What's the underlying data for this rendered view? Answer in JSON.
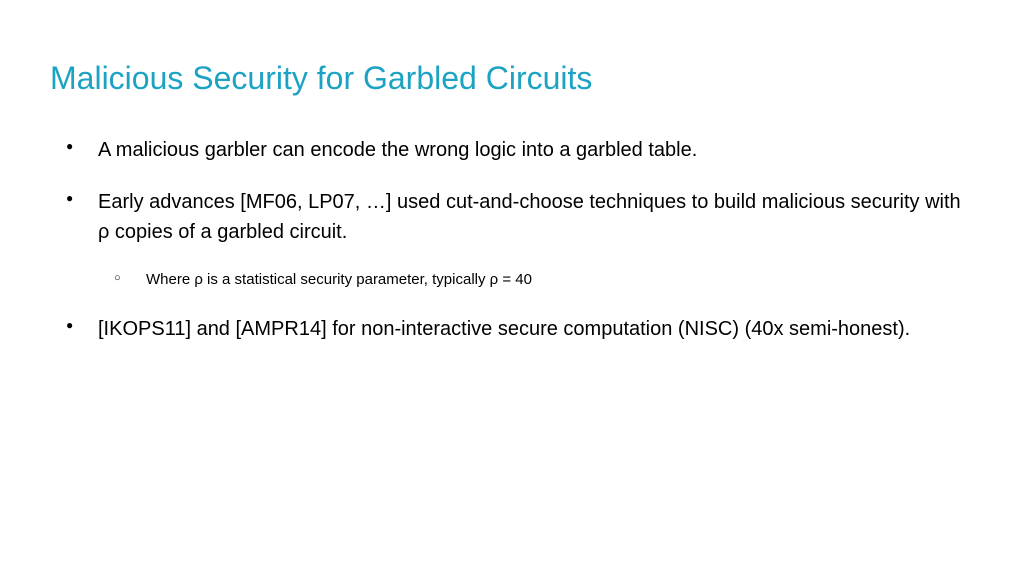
{
  "slide": {
    "title": "Malicious Security for Garbled Circuits",
    "bullets": [
      {
        "text": "A malicious garbler can encode the wrong logic into a garbled table.",
        "sub": []
      },
      {
        "text": "Early advances [MF06, LP07, …] used cut-and-choose techniques to build malicious security with ρ copies of a garbled circuit.",
        "sub": [
          "Where ρ is a statistical security parameter, typically ρ = 40"
        ]
      },
      {
        "text": "[IKOPS11] and [AMPR14] for non-interactive secure computation (NISC) (40x semi-honest).",
        "sub": []
      }
    ]
  }
}
